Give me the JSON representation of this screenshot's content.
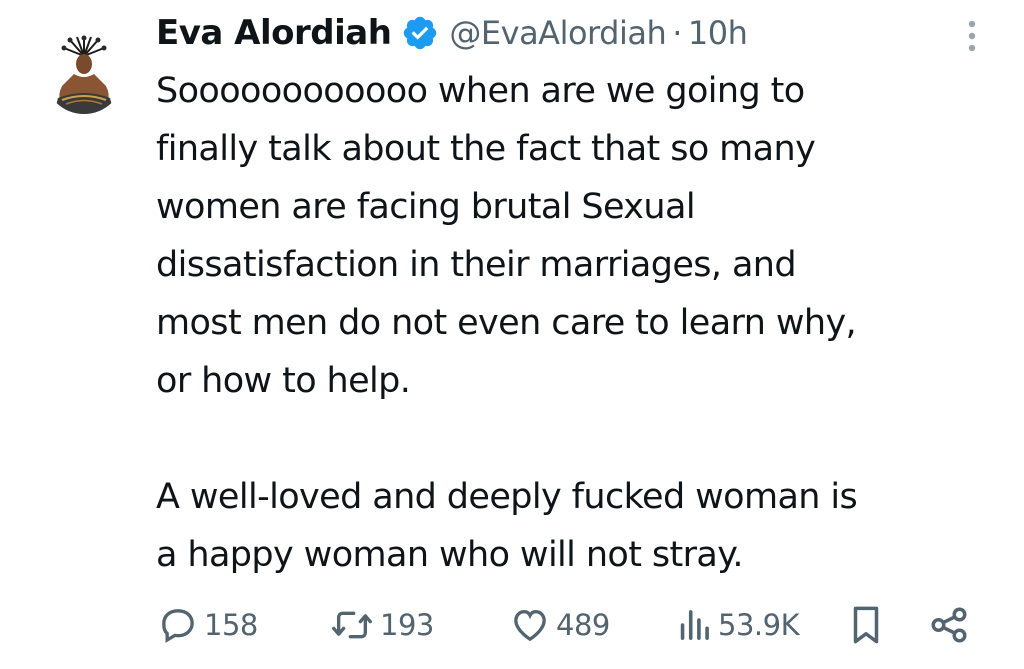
{
  "author": {
    "name": "Eva Alordiah",
    "handle": "@EvaAlordiah",
    "separator": "·",
    "time": "10h",
    "verified_icon": "verified-badge-icon",
    "verified_color": "#1d9bf0"
  },
  "tweet": {
    "paragraph1": "Soooooooooooo when are we going to\nfinally talk about the fact that so many\nwomen are facing brutal Sexual\ndissatisfaction in their marriages, and\nmost men do not even care to learn why,\nor how to help.",
    "paragraph2": "A well-loved and deeply fucked woman is\na happy woman who will not stray."
  },
  "actions": {
    "replies": "158",
    "reposts": "193",
    "likes": "489",
    "views": "53.9K",
    "icons": [
      "reply-icon",
      "repost-icon",
      "like-icon",
      "views-icon",
      "bookmark-icon",
      "share-icon"
    ]
  },
  "colors": {
    "text": "#0f1419",
    "secondary": "#536471",
    "accent": "#1d9bf0"
  }
}
